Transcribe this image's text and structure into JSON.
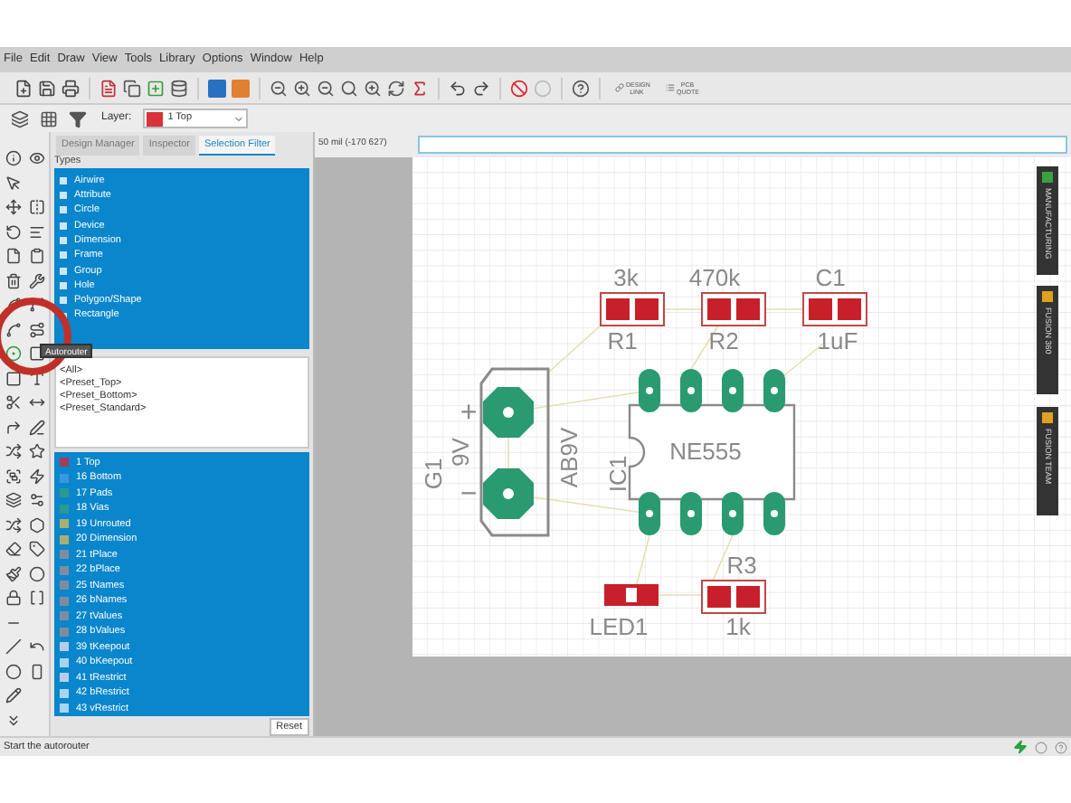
{
  "menu": [
    "File",
    "Edit",
    "Draw",
    "View",
    "Tools",
    "Library",
    "Options",
    "Window",
    "Help"
  ],
  "toolbar_links": [
    {
      "label": "DESIGN LINK"
    },
    {
      "label": "PCB QUOTE"
    }
  ],
  "layer_select": {
    "label": "Layer:",
    "value": "1 Top"
  },
  "panel": {
    "tabs": [
      {
        "label": "Design Manager",
        "selected": false
      },
      {
        "label": "Inspector",
        "selected": false
      },
      {
        "label": "Selection Filter",
        "selected": true
      }
    ],
    "types_heading": "Types",
    "types": [
      {
        "label": "Airwire",
        "selected": true
      },
      {
        "label": "Attribute",
        "selected": true
      },
      {
        "label": "Circle",
        "selected": true
      },
      {
        "label": "Device",
        "selected": true
      },
      {
        "label": "Dimension",
        "selected": true
      },
      {
        "label": "Frame",
        "selected": true
      },
      {
        "label": "Group",
        "selected": true
      },
      {
        "label": "Hole",
        "selected": true
      },
      {
        "label": "Polygon/Shape",
        "selected": true
      },
      {
        "label": "Rectangle",
        "selected": true
      }
    ],
    "presets": [
      {
        "label": "<All>",
        "selected": false
      },
      {
        "label": "<Preset_Top>",
        "selected": false
      },
      {
        "label": "<Preset_Bottom>",
        "selected": false
      },
      {
        "label": "<Preset_Standard>",
        "selected": false
      }
    ],
    "layers": [
      {
        "label": "1 Top",
        "color": "#a83a5a",
        "selected": true
      },
      {
        "label": "16 Bottom",
        "color": "#3a96e0",
        "selected": true
      },
      {
        "label": "17 Pads",
        "color": "#2a9a8c",
        "selected": true
      },
      {
        "label": "18 Vias",
        "color": "#2a9a8c",
        "selected": true
      },
      {
        "label": "19 Unrouted",
        "color": "#a8b070",
        "selected": true
      },
      {
        "label": "20 Dimension",
        "color": "#a8b070",
        "selected": true
      },
      {
        "label": "21 tPlace",
        "color": "#7f8c9c",
        "selected": true
      },
      {
        "label": "22 bPlace",
        "color": "#7f8c9c",
        "selected": true
      },
      {
        "label": "25 tNames",
        "color": "#7f8c9c",
        "selected": true
      },
      {
        "label": "26 bNames",
        "color": "#7f8c9c",
        "selected": true
      },
      {
        "label": "27 tValues",
        "color": "#7f8c9c",
        "selected": true
      },
      {
        "label": "28 bValues",
        "color": "#7f8c9c",
        "selected": true
      },
      {
        "label": "39 tKeepout",
        "color": "#b8cce8",
        "selected": true
      },
      {
        "label": "40 bKeepout",
        "color": "#a8d4f0",
        "selected": true
      },
      {
        "label": "41 tRestrict",
        "color": "#b8cce8",
        "selected": true
      },
      {
        "label": "42 bRestrict",
        "color": "#a8d4f0",
        "selected": true
      },
      {
        "label": "43 vRestrict",
        "color": "#a8d4f0",
        "selected": true
      }
    ],
    "reset": "Reset"
  },
  "canvas": {
    "coordinates": "50 mil (-170 627)"
  },
  "board": {
    "parts": [
      {
        "kind": "resistor",
        "name": "R1",
        "value": "3k"
      },
      {
        "kind": "resistor",
        "name": "R2",
        "value": "470k"
      },
      {
        "kind": "capacitor",
        "name": "C1",
        "value": "1uF"
      },
      {
        "kind": "battery",
        "name": "G1",
        "value": "9V",
        "package": "AB9V",
        "plus": "+",
        "minus": "−"
      },
      {
        "kind": "ic",
        "name": "IC1",
        "value": "NE555"
      },
      {
        "kind": "led",
        "name": "LED1"
      },
      {
        "kind": "resistor",
        "name": "R3",
        "value": "1k"
      }
    ]
  },
  "side_tabs": [
    "MANUFACTURING",
    "FUSION 360",
    "FUSION TEAM"
  ],
  "tooltip": "Autorouter",
  "status_bar": "Start the autorouter"
}
